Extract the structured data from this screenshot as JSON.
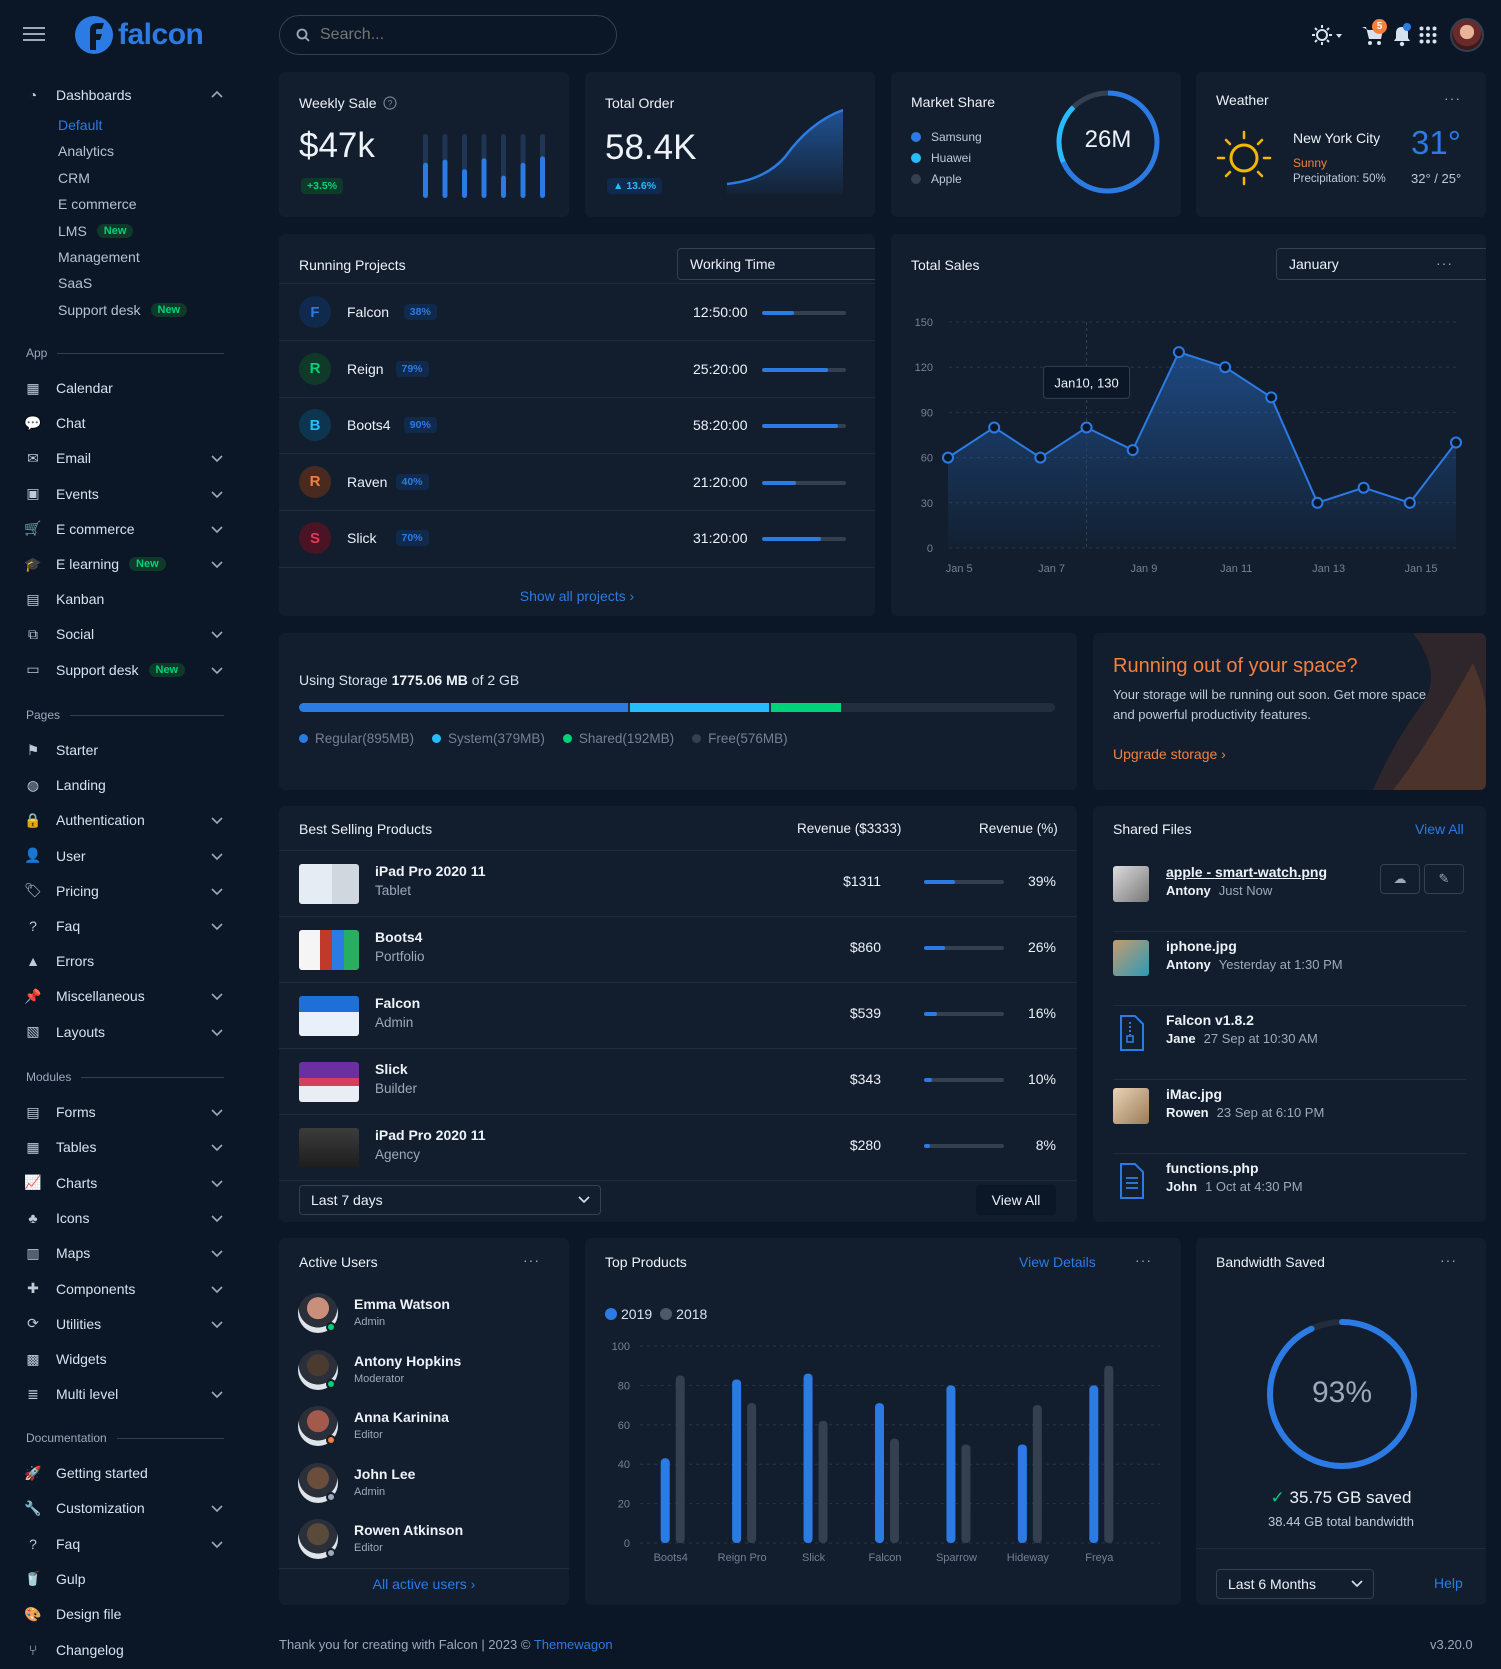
{
  "brand": {
    "name": "falcon"
  },
  "search": {
    "placeholder": "Search..."
  },
  "topbar": {
    "cart_count": "5"
  },
  "sidebar": {
    "dashboards": {
      "label": "Dashboards",
      "items": [
        "Default",
        "Analytics",
        "CRM",
        "E commerce",
        "LMS",
        "Management",
        "SaaS",
        "Support desk"
      ],
      "new": "New"
    },
    "sections": {
      "app": "App",
      "pages": "Pages",
      "modules": "Modules",
      "documentation": "Documentation"
    },
    "app_items": [
      "Calendar",
      "Chat",
      "Email",
      "Events",
      "E commerce",
      "E learning",
      "Kanban",
      "Social",
      "Support desk"
    ],
    "page_items": [
      "Starter",
      "Landing",
      "Authentication",
      "User",
      "Pricing",
      "Faq",
      "Errors",
      "Miscellaneous",
      "Layouts"
    ],
    "module_items": [
      "Forms",
      "Tables",
      "Charts",
      "Icons",
      "Maps",
      "Components",
      "Utilities",
      "Widgets",
      "Multi level"
    ],
    "doc_items": [
      "Getting started",
      "Customization",
      "Faq",
      "Gulp",
      "Design file",
      "Changelog"
    ]
  },
  "weekly_sale": {
    "title": "Weekly Sale",
    "value": "$47k",
    "change": "+3.5%",
    "bars": [
      0.55,
      1.0,
      0.6,
      1.0,
      0.45,
      1.0,
      0.62,
      1.0,
      0.35,
      1.0,
      0.55,
      1.0,
      0.65,
      1.0
    ]
  },
  "total_order": {
    "title": "Total Order",
    "value": "58.4K",
    "change": "13.6%"
  },
  "market_share": {
    "title": "Market Share",
    "center": "26M",
    "legend": [
      "Samsung",
      "Huawei",
      "Apple"
    ],
    "colors": [
      "#2c7be5",
      "#27bcfd",
      "#344050"
    ]
  },
  "weather": {
    "title": "Weather",
    "city": "New York City",
    "condition": "Sunny",
    "precip": "Precipitation: 50%",
    "temp": "31°",
    "range": "32° / 25°"
  },
  "running_projects": {
    "title": "Running Projects",
    "select": "Working Time",
    "footer": "Show all projects",
    "rows": [
      {
        "letter": "F",
        "name": "Falcon",
        "pct": "38%",
        "time": "12:50:00",
        "progress": 0.38,
        "bg": "#0f2a4d",
        "fg": "#2c7be5"
      },
      {
        "letter": "R",
        "name": "Reign",
        "pct": "79%",
        "time": "25:20:00",
        "progress": 0.79,
        "bg": "#0f3a2a",
        "fg": "#00d27a"
      },
      {
        "letter": "B",
        "name": "Boots4",
        "pct": "90%",
        "time": "58:20:00",
        "progress": 0.9,
        "bg": "#0e3550",
        "fg": "#27bcfd"
      },
      {
        "letter": "R",
        "name": "Raven",
        "pct": "40%",
        "time": "21:20:00",
        "progress": 0.4,
        "bg": "#4a2a1e",
        "fg": "#f5803e"
      },
      {
        "letter": "S",
        "name": "Slick",
        "pct": "70%",
        "time": "31:20:00",
        "progress": 0.7,
        "bg": "#4a1424",
        "fg": "#e63757"
      }
    ]
  },
  "total_sales": {
    "title": "Total Sales",
    "select": "January",
    "tooltip": "Jan10, 130"
  },
  "chart_data": [
    {
      "type": "line",
      "title": "Total Sales",
      "x": [
        "Jan 4",
        "Jan 5",
        "Jan 6",
        "Jan 7",
        "Jan 8",
        "Jan 9",
        "Jan 10",
        "Jan 11",
        "Jan 12",
        "Jan 13",
        "Jan 14",
        "Jan 15",
        "Jan 16"
      ],
      "values": [
        60,
        80,
        60,
        80,
        65,
        130,
        120,
        100,
        30,
        40,
        30,
        70
      ],
      "xticks": [
        "Jan 5",
        "Jan 7",
        "Jan 9",
        "Jan 11",
        "Jan 13",
        "Jan 15"
      ],
      "yticks": [
        0,
        30,
        60,
        90,
        120,
        150
      ],
      "ylim": [
        0,
        150
      ]
    },
    {
      "type": "bar",
      "title": "Top Products",
      "categories": [
        "Boots4",
        "Reign Pro",
        "Slick",
        "Falcon",
        "Sparrow",
        "Hideway",
        "Freya"
      ],
      "series": [
        {
          "name": "2019",
          "values": [
            43,
            83,
            86,
            71,
            80,
            50,
            80
          ],
          "color": "#2c7be5"
        },
        {
          "name": "2018",
          "values": [
            85,
            71,
            62,
            53,
            50,
            70,
            90
          ],
          "color": "#344050"
        }
      ],
      "yticks": [
        0,
        20,
        40,
        60,
        80,
        100
      ],
      "ylim": [
        0,
        100
      ]
    }
  ],
  "storage": {
    "label_prefix": "Using Storage",
    "used": "1775.06 MB",
    "label_suffix": "of 2 GB",
    "segments": [
      {
        "label": "Regular(895MB)",
        "fraction": 0.437,
        "color": "#2c7be5"
      },
      {
        "label": "System(379MB)",
        "fraction": 0.185,
        "color": "#27bcfd"
      },
      {
        "label": "Shared(192MB)",
        "fraction": 0.094,
        "color": "#00d27a"
      },
      {
        "label": "Free(576MB)",
        "fraction": 0.284,
        "color": "#232e3c"
      }
    ]
  },
  "space_promo": {
    "title": "Running out of your space?",
    "text": "Your storage will be running out soon. Get more space and powerful productivity features.",
    "link": "Upgrade storage"
  },
  "best_selling": {
    "title": "Best Selling Products",
    "col_revenue": "Revenue ($3333)",
    "col_pct": "Revenue (%)",
    "rows": [
      {
        "name": "iPad Pro 2020 11",
        "sub": "Tablet",
        "revenue": "$1311",
        "pct": "39%",
        "progress": 0.39
      },
      {
        "name": "Boots4",
        "sub": "Portfolio",
        "revenue": "$860",
        "pct": "26%",
        "progress": 0.26
      },
      {
        "name": "Falcon",
        "sub": "Admin",
        "revenue": "$539",
        "pct": "16%",
        "progress": 0.16
      },
      {
        "name": "Slick",
        "sub": "Builder",
        "revenue": "$343",
        "pct": "10%",
        "progress": 0.1
      },
      {
        "name": "iPad Pro 2020 11",
        "sub": "Agency",
        "revenue": "$280",
        "pct": "8%",
        "progress": 0.08
      }
    ],
    "select": "Last 7 days",
    "view_all": "View All"
  },
  "shared_files": {
    "title": "Shared Files",
    "view_all": "View All",
    "files": [
      {
        "name": "apple - smart-watch.png",
        "user": "Antony",
        "time": "Just Now"
      },
      {
        "name": "iphone.jpg",
        "user": "Antony",
        "time": "Yesterday at 1:30 PM"
      },
      {
        "name": "Falcon v1.8.2",
        "user": "Jane",
        "time": "27 Sep at 10:30 AM"
      },
      {
        "name": "iMac.jpg",
        "user": "Rowen",
        "time": "23 Sep at 6:10 PM"
      },
      {
        "name": "functions.php",
        "user": "John",
        "time": "1 Oct at 4:30 PM"
      }
    ]
  },
  "active_users": {
    "title": "Active Users",
    "footer": "All active users",
    "users": [
      {
        "name": "Emma Watson",
        "role": "Admin",
        "status": "#00d27a"
      },
      {
        "name": "Antony Hopkins",
        "role": "Moderator",
        "status": "#00d27a"
      },
      {
        "name": "Anna Karinina",
        "role": "Editor",
        "status": "#f5803e"
      },
      {
        "name": "John Lee",
        "role": "Admin",
        "status": "#9da9bb"
      },
      {
        "name": "Rowen Atkinson",
        "role": "Editor",
        "status": "#9da9bb"
      }
    ]
  },
  "top_products": {
    "title": "Top Products",
    "link": "View Details"
  },
  "bandwidth": {
    "title": "Bandwidth Saved",
    "pct": "93%",
    "progress": 0.93,
    "saved": "35.75 GB saved",
    "total": "38.44 GB total bandwidth",
    "select": "Last 6 Months",
    "help": "Help"
  },
  "footer": {
    "text": "Thank you for creating with Falcon | 2023 ©",
    "link": "Themewagon",
    "version": "v3.20.0"
  }
}
